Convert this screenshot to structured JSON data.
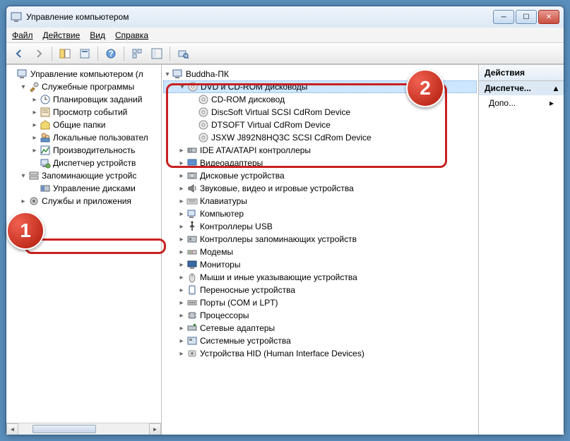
{
  "title": "Управление компьютером",
  "menus": [
    "Файл",
    "Действие",
    "Вид",
    "Справка"
  ],
  "left_tree": [
    {
      "level": 0,
      "toggle": "",
      "icon": "mgmt",
      "label": "Управление компьютером (л"
    },
    {
      "level": 1,
      "toggle": "▾",
      "icon": "tools",
      "label": "Служебные программы"
    },
    {
      "level": 2,
      "toggle": "▸",
      "icon": "sched",
      "label": "Планировщик заданий"
    },
    {
      "level": 2,
      "toggle": "▸",
      "icon": "event",
      "label": "Просмотр событий"
    },
    {
      "level": 2,
      "toggle": "▸",
      "icon": "share",
      "label": "Общие папки"
    },
    {
      "level": 2,
      "toggle": "▸",
      "icon": "users",
      "label": "Локальные пользовател"
    },
    {
      "level": 2,
      "toggle": "▸",
      "icon": "perf",
      "label": "Производительность"
    },
    {
      "level": 2,
      "toggle": "",
      "icon": "devmgr",
      "label": "Диспетчер устройств",
      "hl": true
    },
    {
      "level": 1,
      "toggle": "▾",
      "icon": "storage",
      "label": "Запоминающие устройс"
    },
    {
      "level": 2,
      "toggle": "",
      "icon": "diskmgmt",
      "label": "Управление дисками"
    },
    {
      "level": 1,
      "toggle": "▸",
      "icon": "services",
      "label": "Службы и приложения"
    }
  ],
  "center_root": "Buddha-ПК",
  "center_tree": [
    {
      "level": 1,
      "toggle": "▾",
      "icon": "dvd",
      "label": "DVD и CD-ROM дисководы",
      "sel": true
    },
    {
      "level": 2,
      "toggle": "",
      "icon": "disc",
      "label": "CD-ROM дисковод"
    },
    {
      "level": 2,
      "toggle": "",
      "icon": "disc",
      "label": "DiscSoft Virtual SCSI CdRom Device"
    },
    {
      "level": 2,
      "toggle": "",
      "icon": "disc",
      "label": "DTSOFT Virtual CdRom Device"
    },
    {
      "level": 2,
      "toggle": "",
      "icon": "disc",
      "label": "JSXW J892N8HQ3C SCSI CdRom Device"
    },
    {
      "level": 1,
      "toggle": "▸",
      "icon": "ide",
      "label": "IDE ATA/ATAPI контроллеры"
    },
    {
      "level": 1,
      "toggle": "▸",
      "icon": "display",
      "label": "Видеоадаптеры"
    },
    {
      "level": 1,
      "toggle": "▸",
      "icon": "disk",
      "label": "Дисковые устройства"
    },
    {
      "level": 1,
      "toggle": "▸",
      "icon": "sound",
      "label": "Звуковые, видео и игровые устройства"
    },
    {
      "level": 1,
      "toggle": "▸",
      "icon": "keyboard",
      "label": "Клавиатуры"
    },
    {
      "level": 1,
      "toggle": "▸",
      "icon": "computer",
      "label": "Компьютер"
    },
    {
      "level": 1,
      "toggle": "▸",
      "icon": "usb",
      "label": "Контроллеры USB"
    },
    {
      "level": 1,
      "toggle": "▸",
      "icon": "storage-ctl",
      "label": "Контроллеры запоминающих устройств"
    },
    {
      "level": 1,
      "toggle": "▸",
      "icon": "modem",
      "label": "Модемы"
    },
    {
      "level": 1,
      "toggle": "▸",
      "icon": "monitor",
      "label": "Мониторы"
    },
    {
      "level": 1,
      "toggle": "▸",
      "icon": "mouse",
      "label": "Мыши и иные указывающие устройства"
    },
    {
      "level": 1,
      "toggle": "▸",
      "icon": "portable",
      "label": "Переносные устройства"
    },
    {
      "level": 1,
      "toggle": "▸",
      "icon": "ports",
      "label": "Порты (COM и LPT)"
    },
    {
      "level": 1,
      "toggle": "▸",
      "icon": "cpu",
      "label": "Процессоры"
    },
    {
      "level": 1,
      "toggle": "▸",
      "icon": "net",
      "label": "Сетевые адаптеры"
    },
    {
      "level": 1,
      "toggle": "▸",
      "icon": "system",
      "label": "Системные устройства"
    },
    {
      "level": 1,
      "toggle": "▸",
      "icon": "hid",
      "label": "Устройства HID (Human Interface Devices)"
    }
  ],
  "actions": {
    "header": "Действия",
    "group": "Диспетче...",
    "item": "Допо..."
  },
  "callouts": {
    "c1": "1",
    "c2": "2"
  }
}
